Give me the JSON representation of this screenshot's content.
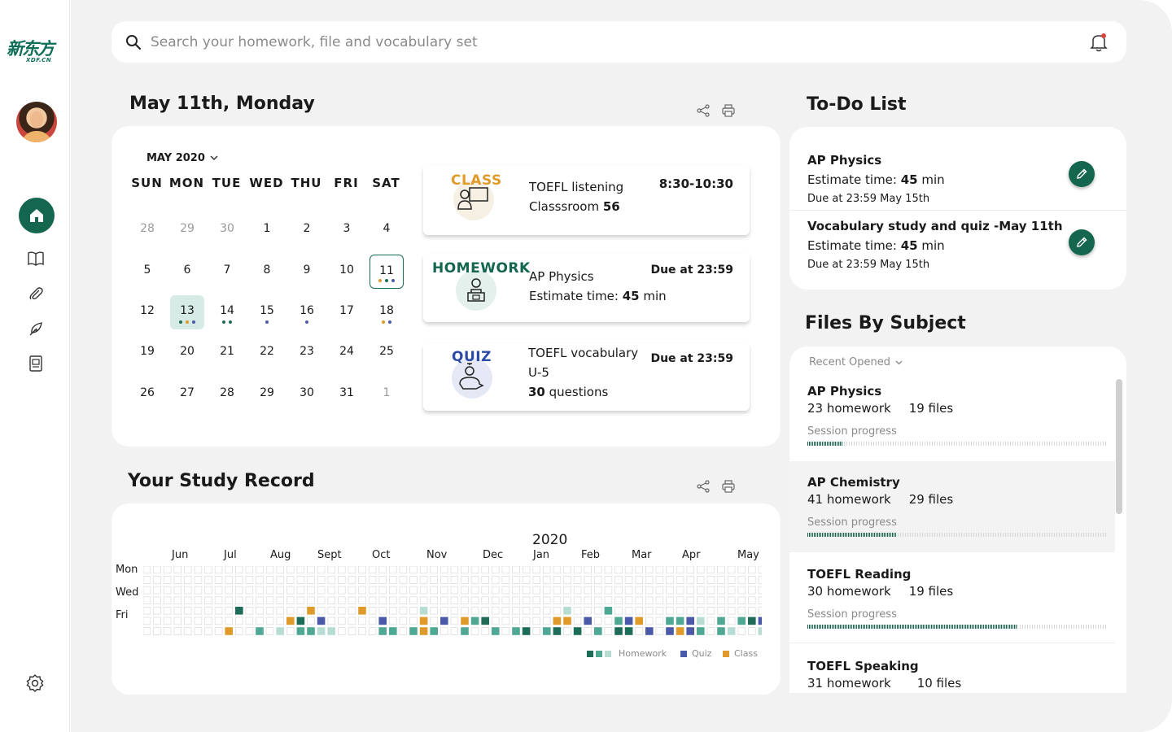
{
  "logo": {
    "chinese": "新东方",
    "domain": "XDF.CN"
  },
  "search": {
    "placeholder": "Search your homework, file and vocabulary set"
  },
  "calendar": {
    "heading": "May 11th, Monday",
    "month_label": "MAY 2020",
    "weekdays": [
      "SUN",
      "MON",
      "TUE",
      "WED",
      "THU",
      "FRI",
      "SAT"
    ],
    "weeks": [
      [
        "28",
        "29",
        "30",
        "1",
        "2",
        "3",
        "4"
      ],
      [
        "5",
        "6",
        "7",
        "8",
        "9",
        "10",
        "11"
      ],
      [
        "12",
        "13",
        "14",
        "15",
        "16",
        "17",
        "18"
      ],
      [
        "19",
        "20",
        "21",
        "22",
        "23",
        "24",
        "25"
      ],
      [
        "26",
        "27",
        "28",
        "29",
        "30",
        "31",
        "1"
      ]
    ],
    "today": "11",
    "selected": "13"
  },
  "events": [
    {
      "kind": "CLASS",
      "title": "TOEFL listening",
      "detail_prefix": "Classsroom ",
      "detail_value": "56",
      "right": "8:30-10:30"
    },
    {
      "kind": "HOMEWORK",
      "title": "AP Physics",
      "detail_prefix": "Estimate time: ",
      "detail_value": "45",
      "detail_suffix": " min",
      "right": "Due at 23:59"
    },
    {
      "kind": "QUIZ",
      "title": "TOEFL vocabulary",
      "title2": "U-5",
      "detail_value": "30",
      "detail_suffix": " questions",
      "right": "Due at 23:59"
    }
  ],
  "study_record": {
    "heading": "Your Study Record",
    "year": "2020",
    "months": [
      "Jun",
      "Jul",
      "Aug",
      "Sept",
      "Oct",
      "Nov",
      "Dec",
      "Jan",
      "Feb",
      "Mar",
      "Apr",
      "May"
    ],
    "row_labels": [
      "Mon",
      "Wed",
      "Fri"
    ],
    "legend": {
      "homework": "Homework",
      "quiz": "Quiz",
      "class": "Class"
    }
  },
  "todo": {
    "heading": "To-Do List",
    "items": [
      {
        "title": "AP Physics",
        "estimate_prefix": "Estimate time: ",
        "estimate_value": "45",
        "estimate_suffix": " min",
        "due": "Due at 23:59 May 15th"
      },
      {
        "title": "Vocabulary study and quiz -May 11th",
        "estimate_prefix": "Estimate time: ",
        "estimate_value": "45",
        "estimate_suffix": " min",
        "due": "Due at 23:59 May 15th"
      }
    ]
  },
  "files": {
    "heading": "Files By Subject",
    "sort_label": "Recent Opened",
    "progress_label": "Session progress",
    "items": [
      {
        "name": "AP Physics",
        "homework": "23 homework",
        "files": "19 files",
        "progress": 0.12
      },
      {
        "name": "AP Chemistry",
        "homework": "41 homework",
        "files": "29 files",
        "progress": 0.3
      },
      {
        "name": "TOEFL  Reading",
        "homework": "30 homework",
        "files": "19 files",
        "progress": 0.7
      },
      {
        "name": "TOEFL Speaking",
        "homework": "31 homework",
        "files": "10 files"
      }
    ]
  },
  "colors": {
    "brand_green": "#14664f",
    "homework_dark": "#1c6c58",
    "homework_mid": "#4fa894",
    "homework_light": "#b7dcd3",
    "quiz": "#4a5aa8",
    "class": "#e09a2a"
  }
}
